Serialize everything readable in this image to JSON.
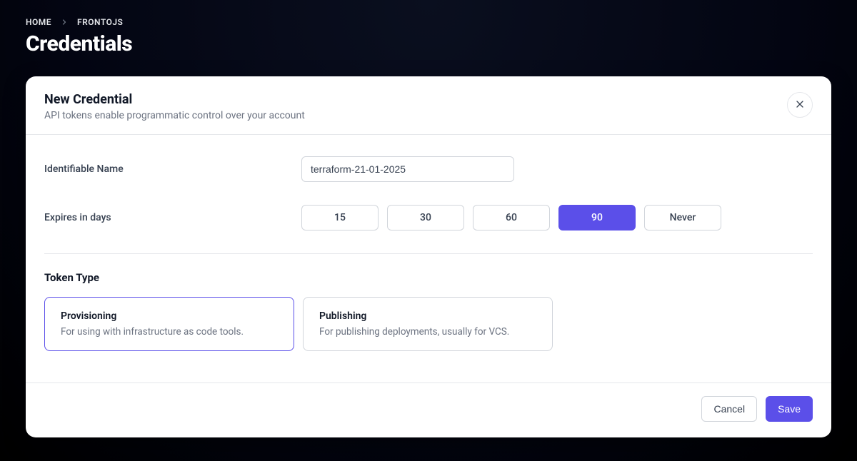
{
  "breadcrumb": {
    "items": [
      "HOME",
      "FRONTOJS"
    ]
  },
  "page": {
    "title": "Credentials"
  },
  "panel": {
    "title": "New Credential",
    "subtitle": "API tokens enable programmatic control over your account"
  },
  "form": {
    "name_label": "Identifiable Name",
    "name_value": "terraform-21-01-2025",
    "expires_label": "Expires in days",
    "expires_options": [
      "15",
      "30",
      "60",
      "90",
      "Never"
    ],
    "expires_selected": "90",
    "token_type_heading": "Token Type",
    "token_types": [
      {
        "title": "Provisioning",
        "desc": "For using with infrastructure as code tools.",
        "selected": true
      },
      {
        "title": "Publishing",
        "desc": "For publishing deployments, usually for VCS.",
        "selected": false
      }
    ]
  },
  "actions": {
    "cancel": "Cancel",
    "save": "Save"
  }
}
